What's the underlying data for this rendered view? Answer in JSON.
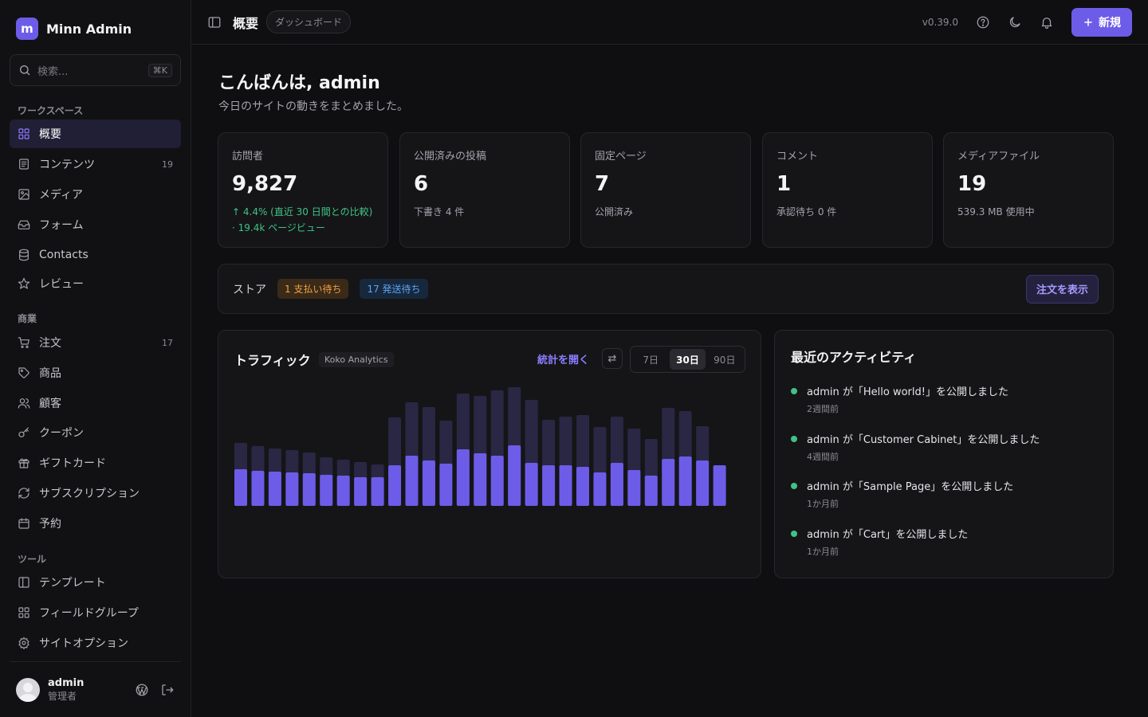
{
  "sidebar": {
    "brand": {
      "logo_letter": "m",
      "name": "Minn Admin"
    },
    "search": {
      "placeholder": "検索...",
      "shortcut": "⌘K"
    },
    "sections": {
      "workspace": "ワークスペース",
      "commerce": "商業",
      "tools": "ツール"
    },
    "workspace_items": [
      {
        "label": "概要",
        "icon": "grid-icon",
        "active": true
      },
      {
        "label": "コンテンツ",
        "icon": "document-icon",
        "count": "19"
      },
      {
        "label": "メディア",
        "icon": "image-icon"
      },
      {
        "label": "フォーム",
        "icon": "inbox-icon"
      },
      {
        "label": "Contacts",
        "icon": "database-icon"
      },
      {
        "label": "レビュー",
        "icon": "star-icon"
      }
    ],
    "commerce_items": [
      {
        "label": "注文",
        "icon": "cart-icon",
        "count": "17"
      },
      {
        "label": "商品",
        "icon": "tag-icon"
      },
      {
        "label": "顧客",
        "icon": "users-icon"
      },
      {
        "label": "クーポン",
        "icon": "key-icon"
      },
      {
        "label": "ギフトカード",
        "icon": "gift-icon"
      },
      {
        "label": "サブスクリプション",
        "icon": "refresh-icon"
      },
      {
        "label": "予約",
        "icon": "calendar-icon"
      }
    ],
    "tools_items": [
      {
        "label": "テンプレート",
        "icon": "columns-icon"
      },
      {
        "label": "フィールドグループ",
        "icon": "grid-icon"
      },
      {
        "label": "サイトオプション",
        "icon": "gear-icon"
      }
    ],
    "user": {
      "name": "admin",
      "role": "管理者"
    }
  },
  "topbar": {
    "title": "概要",
    "crumb": "ダッシュボード",
    "version": "v0.39.0",
    "new_button": "新規"
  },
  "main": {
    "greeting": "こんばんは, admin",
    "greeting_sub": "今日のサイトの動きをまとめました。",
    "stats": [
      {
        "label": "訪問者",
        "value": "9,827",
        "sub1": "↑ 4.4% (直近 30 日間との比較)",
        "sub2": "· 19.4k ページビュー"
      },
      {
        "label": "公開済みの投稿",
        "value": "6",
        "sub1": "下書き 4 件"
      },
      {
        "label": "固定ページ",
        "value": "7",
        "sub1": "公開済み"
      },
      {
        "label": "コメント",
        "value": "1",
        "sub1": "承認待ち 0 件"
      },
      {
        "label": "メディアファイル",
        "value": "19",
        "sub1": "539.3 MB 使用中"
      }
    ],
    "store": {
      "label": "ストア",
      "pending_payment": "1 支払い待ち",
      "pending_shipping": "17 発送待ち",
      "view_orders": "注文を表示"
    },
    "traffic": {
      "title": "トラフィック",
      "source": "Koko Analytics",
      "open_stats": "統計を開く",
      "ranges": [
        "7日",
        "30日",
        "90日"
      ],
      "active_range": "30日"
    },
    "activity": {
      "title": "最近のアクティビティ",
      "items": [
        {
          "text": "admin が「Hello world!」を公開しました",
          "time": "2週間前"
        },
        {
          "text": "admin が「Customer Cabinet」を公開しました",
          "time": "4週間前"
        },
        {
          "text": "admin が「Sample Page」を公開しました",
          "time": "1か月前"
        },
        {
          "text": "admin が「Cart」を公開しました",
          "time": "1か月前"
        }
      ]
    }
  },
  "colors": {
    "accent": "#6d5ce8",
    "visitors": "#6d5ce8",
    "pageviews": "#2a2744",
    "positive": "#3fc383"
  },
  "chart_data": {
    "type": "bar",
    "series": [
      {
        "values": [
          79,
          75,
          72,
          70,
          67,
          61,
          58,
          55,
          52,
          111,
          130,
          124,
          107,
          141,
          138,
          145,
          149,
          133,
          108,
          112,
          114,
          99,
          112,
          97,
          84,
          123,
          119,
          100
        ]
      },
      {
        "values": [
          46,
          44,
          43,
          42,
          41,
          39,
          38,
          36,
          36,
          51,
          63,
          57,
          53,
          71,
          66,
          63,
          76,
          54,
          51,
          51,
          49,
          42,
          54,
          45,
          38,
          59,
          62,
          57,
          51
        ]
      }
    ],
    "ylim": [
      0,
      150
    ],
    "grid": false
  }
}
